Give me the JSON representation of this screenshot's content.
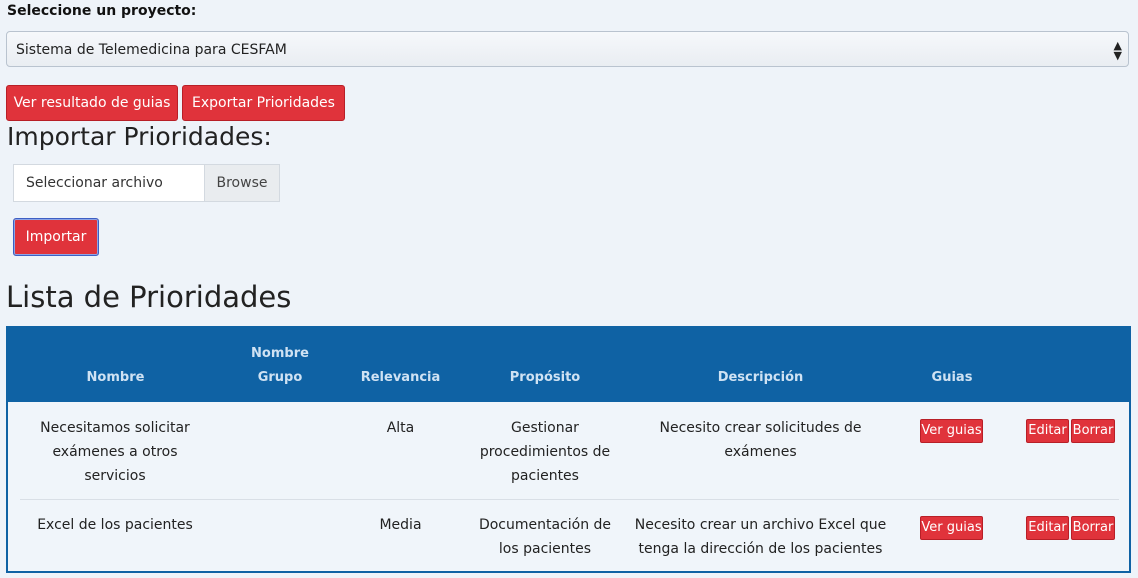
{
  "header": {
    "project_label": "Seleccione un proyecto:",
    "project_selected": "Sistema de Telemedicina para CESFAM"
  },
  "actions": {
    "view_guides": "Ver resultado de guias",
    "export": "Exportar Prioridades"
  },
  "import": {
    "title": "Importar Prioridades:",
    "file_placeholder": "Seleccionar archivo",
    "browse": "Browse",
    "import_button": "Importar"
  },
  "list": {
    "title": "Lista de Prioridades",
    "columns": [
      "Nombre",
      "Nombre Grupo",
      "Relevancia",
      "Propósito",
      "Descripción",
      "Guias"
    ],
    "rows": [
      {
        "nombre": "Necesitamos solicitar exámenes a otros servicios",
        "grupo": "",
        "relevancia": "Alta",
        "proposito": "Gestionar procedimientos de pacientes",
        "descripcion": "Necesito crear solicitudes de exámenes",
        "ver_guias": "Ver guias",
        "editar": "Editar",
        "borrar": "Borrar"
      },
      {
        "nombre": "Excel de los pacientes",
        "grupo": "",
        "relevancia": "Media",
        "proposito": "Documentación de los pacientes",
        "descripcion": "Necesito crear un archivo Excel que tenga la dirección de los pacientes",
        "ver_guias": "Ver guias",
        "editar": "Editar",
        "borrar": "Borrar"
      }
    ]
  },
  "colors": {
    "accent_red": "#e0333b",
    "table_header": "#0f62a4",
    "background": "#eef3f9"
  }
}
